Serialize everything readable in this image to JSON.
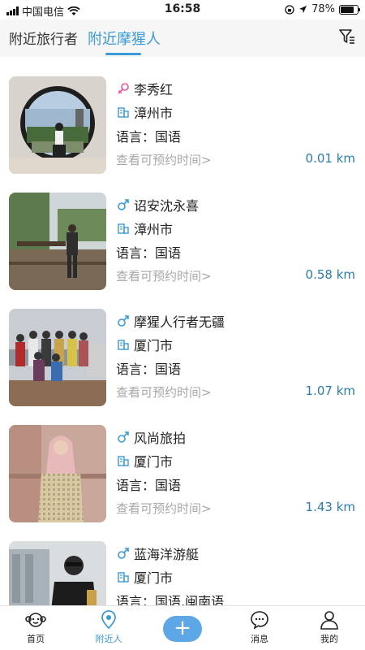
{
  "status_bar": {
    "carrier": "中国电信",
    "time": "16:58",
    "battery": "78%",
    "battery_level": 0.78
  },
  "tabs": [
    {
      "label": "附近旅行者",
      "active": false
    },
    {
      "label": "附近摩猩人",
      "active": true
    }
  ],
  "filter_icon": "filter-icon",
  "accent_color": "#3a9bd5",
  "guides": [
    {
      "name": "李秀红",
      "gender": "female",
      "city": "漳州市",
      "language": "语言：国语",
      "link": "查看可预约时间>",
      "distance": "0.01 km"
    },
    {
      "name": "诏安沈永喜",
      "gender": "male",
      "city": "漳州市",
      "language": "语言：国语",
      "link": "查看可预约时间>",
      "distance": "0.58 km"
    },
    {
      "name": "摩猩人行者无疆",
      "gender": "male",
      "city": "厦门市",
      "language": "语言：国语",
      "link": "查看可预约时间>",
      "distance": "1.07 km"
    },
    {
      "name": "风尚旅拍",
      "gender": "male",
      "city": "厦门市",
      "language": "语言：国语",
      "link": "查看可预约时间>",
      "distance": "1.43 km"
    },
    {
      "name": "蓝海洋游艇",
      "gender": "male",
      "city": "厦门市",
      "language": "语言：国语,闽南语",
      "link": "",
      "distance": ""
    }
  ],
  "bottom_nav": [
    {
      "label": "首页",
      "icon": "monkey-icon"
    },
    {
      "label": "附近人",
      "icon": "location-pin-icon"
    },
    {
      "label": "",
      "icon": "plus-icon"
    },
    {
      "label": "消息",
      "icon": "chat-bubble-icon"
    },
    {
      "label": "我的",
      "icon": "person-icon"
    }
  ]
}
